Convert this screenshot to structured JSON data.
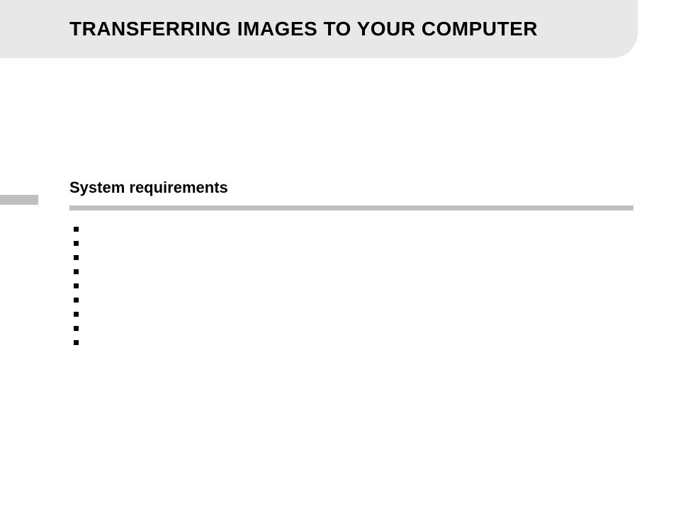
{
  "header": {
    "title": "TRANSFERRING IMAGES TO YOUR COMPUTER"
  },
  "section": {
    "heading": "System requirements",
    "bullets": [
      {
        "text": ""
      },
      {
        "text": ""
      },
      {
        "text": ""
      },
      {
        "text": ""
      },
      {
        "text": ""
      },
      {
        "text": ""
      },
      {
        "text": ""
      },
      {
        "text": ""
      },
      {
        "text": ""
      }
    ]
  }
}
